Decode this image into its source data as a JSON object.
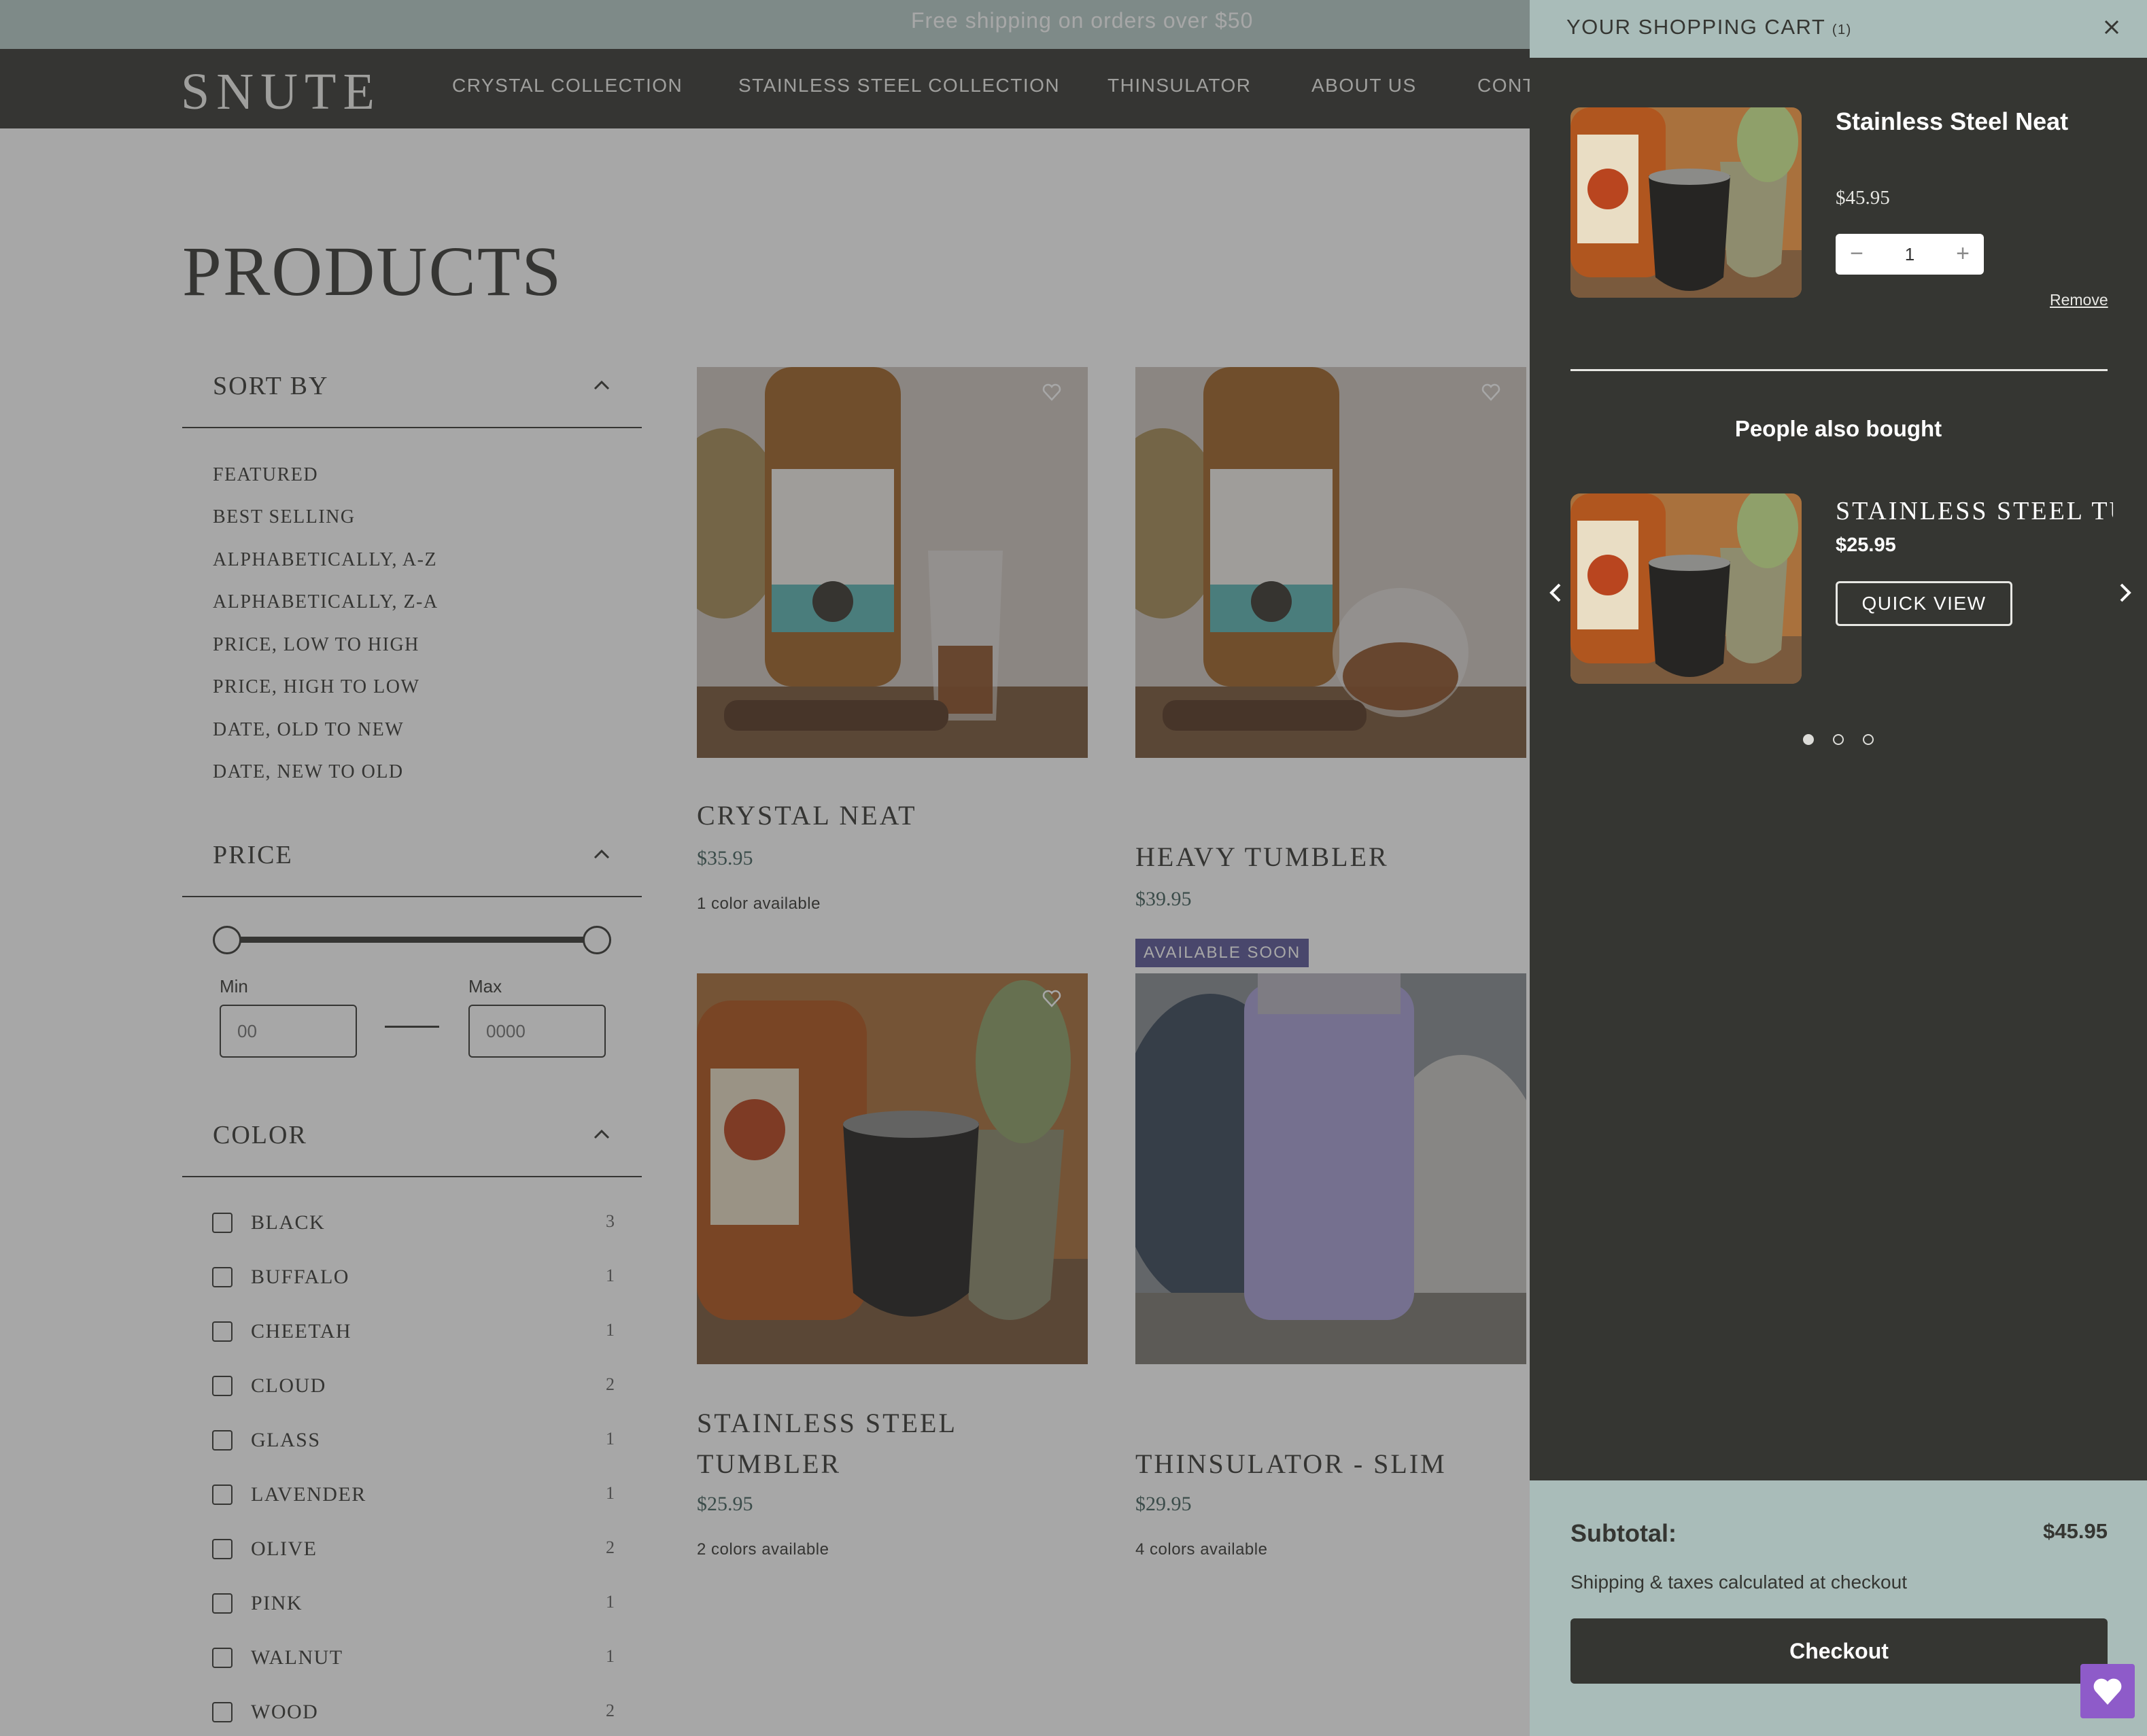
{
  "announcement": "Free shipping on orders over $50",
  "brand": "SNUTE",
  "nav": [
    "CRYSTAL COLLECTION",
    "STAINLESS STEEL COLLECTION",
    "THINSULATOR",
    "ABOUT US",
    "CONT"
  ],
  "page_title": "PRODUCTS",
  "sort": {
    "heading": "SORT BY",
    "options": [
      "FEATURED",
      "BEST SELLING",
      "ALPHABETICALLY, A-Z",
      "ALPHABETICALLY, Z-A",
      "PRICE, LOW TO HIGH",
      "PRICE, HIGH TO LOW",
      "DATE, OLD TO NEW",
      "DATE, NEW TO OLD"
    ]
  },
  "price_filter": {
    "heading": "PRICE",
    "min_label": "Min",
    "max_label": "Max",
    "min_placeholder": "00",
    "max_placeholder": "0000"
  },
  "color_filter": {
    "heading": "COLOR",
    "options": [
      {
        "name": "BLACK",
        "count": "3"
      },
      {
        "name": "BUFFALO",
        "count": "1"
      },
      {
        "name": "CHEETAH",
        "count": "1"
      },
      {
        "name": "CLOUD",
        "count": "2"
      },
      {
        "name": "GLASS",
        "count": "1"
      },
      {
        "name": "LAVENDER",
        "count": "1"
      },
      {
        "name": "OLIVE",
        "count": "2"
      },
      {
        "name": "PINK",
        "count": "1"
      },
      {
        "name": "WALNUT",
        "count": "1"
      },
      {
        "name": "WOOD",
        "count": "2"
      }
    ]
  },
  "products": [
    {
      "name": "CRYSTAL NEAT",
      "price": "$35.95",
      "colors": "1 color available"
    },
    {
      "name": "HEAVY TUMBLER",
      "price": "$39.95",
      "colors": ""
    },
    {
      "name_line1": "STAINLESS STEEL",
      "name_line2": "TUMBLER",
      "price": "$25.95",
      "colors": "2 colors available"
    },
    {
      "name": "THINSULATOR - SLIM",
      "price": "$29.95",
      "colors": "4 colors available",
      "badge": "AVAILABLE SOON"
    }
  ],
  "cart": {
    "title": "YOUR SHOPPING CART",
    "count": "(1)",
    "item": {
      "name": "Stainless Steel Neat",
      "price": "$45.95",
      "qty": "1",
      "remove": "Remove"
    },
    "also_bought": {
      "heading": "People also bought",
      "name": "STAINLESS STEEL TU",
      "price": "$25.95",
      "button": "QUICK VIEW"
    },
    "subtotal_label": "Subtotal:",
    "subtotal": "$45.95",
    "shipping_note": "Shipping & taxes calculated at checkout",
    "checkout": "Checkout"
  },
  "icons": [
    "close-icon",
    "chevron-up-icon",
    "heart-icon",
    "chevron-left-icon",
    "chevron-right-icon",
    "minus-icon",
    "plus-icon"
  ],
  "colors": {
    "dark": "#353632",
    "sage": "#a9bcb9",
    "accent_green": "#46625f",
    "badge": "#5e5a9a",
    "wishlist": "#8e5bc9"
  }
}
